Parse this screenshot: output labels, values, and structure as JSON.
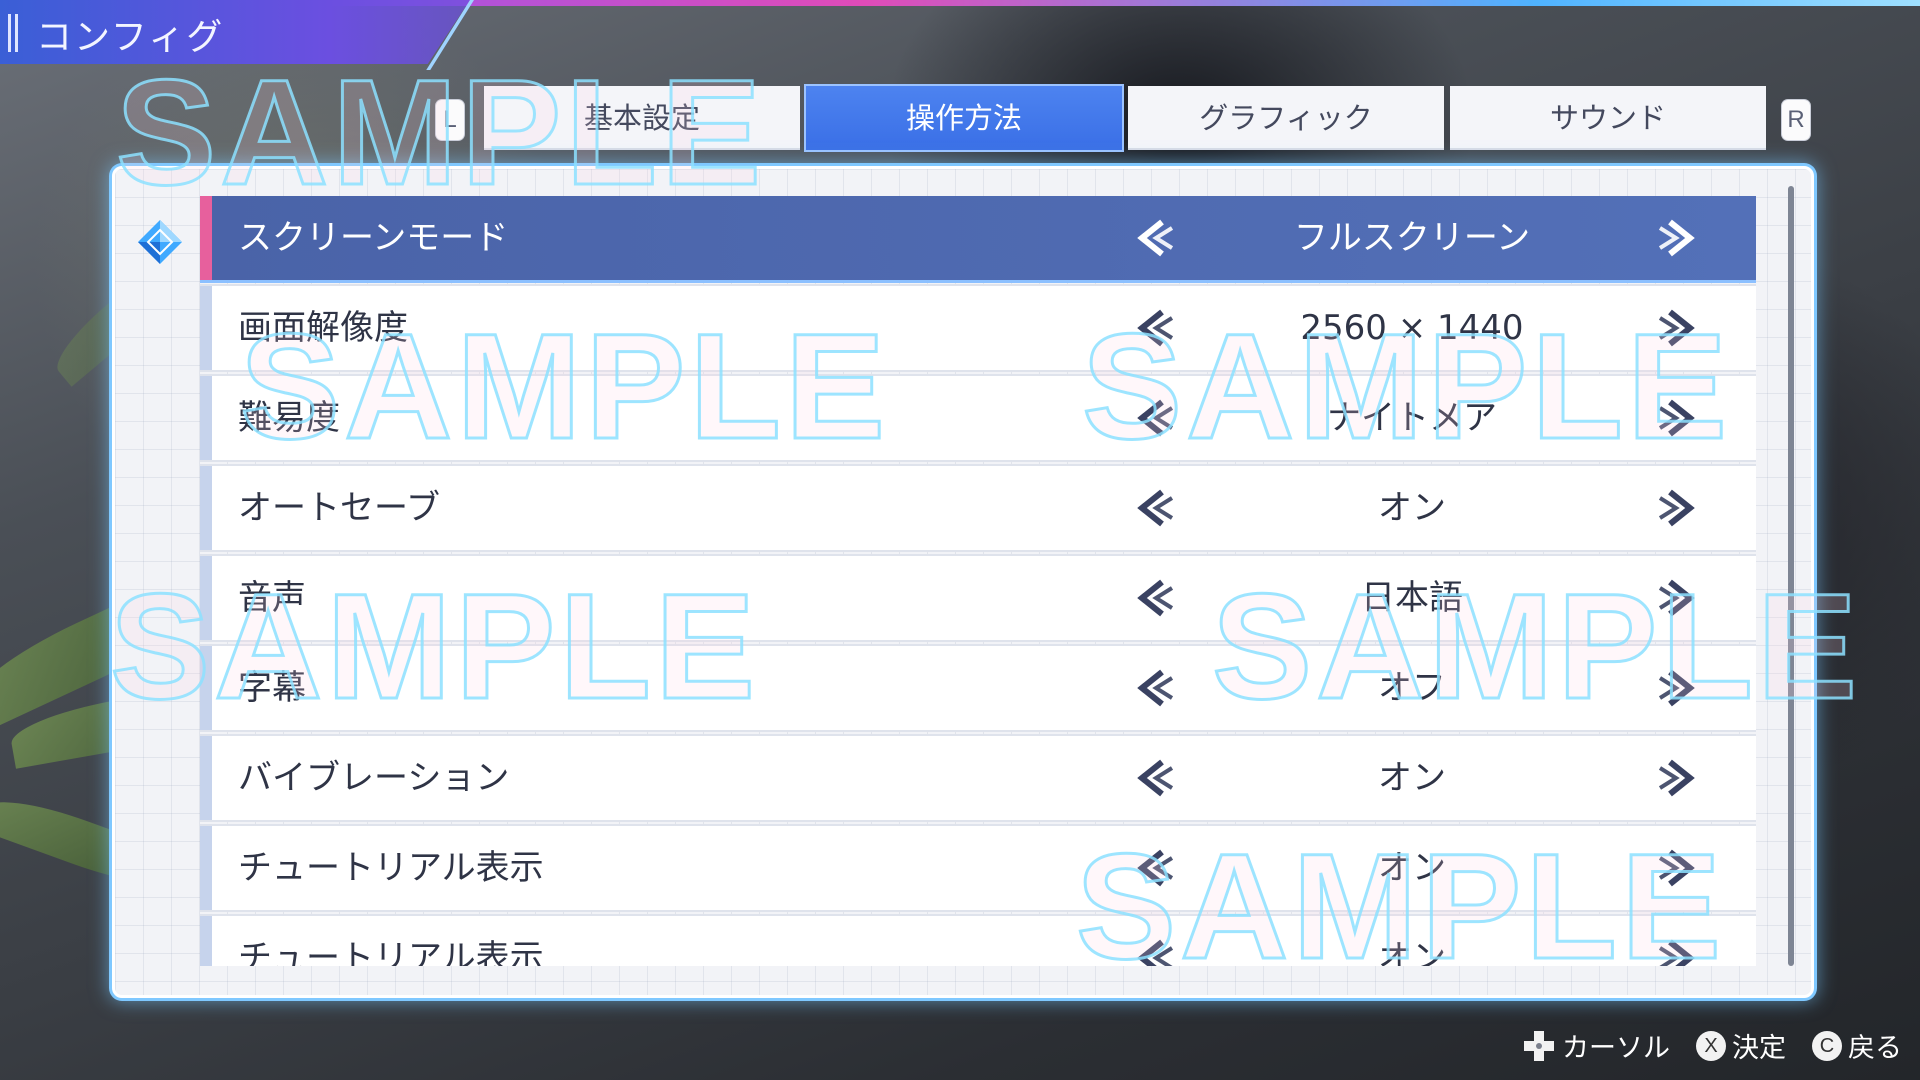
{
  "header": {
    "title": "コンフィグ"
  },
  "tabs": {
    "left_badge": "L",
    "right_badge": "R",
    "items": [
      {
        "label": "基本設定",
        "active": false
      },
      {
        "label": "操作方法",
        "active": true
      },
      {
        "label": "グラフィック",
        "active": false
      },
      {
        "label": "サウンド",
        "active": false
      }
    ]
  },
  "settings": [
    {
      "label": "スクリーンモード",
      "value": "フルスクリーン",
      "selected": true
    },
    {
      "label": "画面解像度",
      "value": "2560 × 1440"
    },
    {
      "label": "難易度",
      "value": "ナイトメア"
    },
    {
      "label": "オートセーブ",
      "value": "オン"
    },
    {
      "label": "音声",
      "value": "日本語"
    },
    {
      "label": "字幕",
      "value": "オフ"
    },
    {
      "label": "バイブレーション",
      "value": "オン"
    },
    {
      "label": "チュートリアル表示",
      "value": "オン"
    },
    {
      "label": "チュートリアル表示",
      "value": "オン"
    }
  ],
  "watermark": "SAMPLE",
  "footer": {
    "cursor": "カーソル",
    "confirm_button": "X",
    "confirm": "決定",
    "back_button": "C",
    "back": "戻る"
  },
  "colors": {
    "accent": "#3a6fe6",
    "selected_row": "#4a63a8",
    "selected_marker": "#e7609d",
    "panel_glow": "#7fc8ff"
  },
  "icons": [
    "dpad-icon",
    "arrow-left-icon",
    "arrow-right-icon",
    "diamond-cursor-icon"
  ]
}
